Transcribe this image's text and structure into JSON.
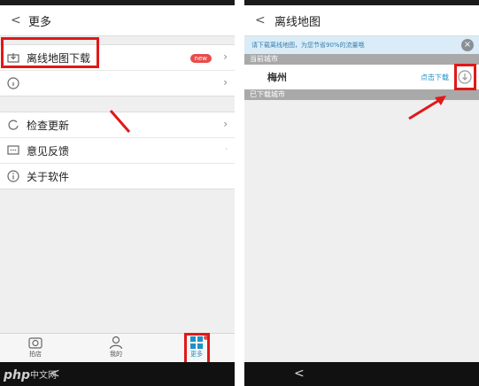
{
  "left_screen": {
    "header": {
      "back_glyph": "<",
      "title": "更多"
    },
    "menu_top": [
      {
        "label": "离线地图下载",
        "badge": "new",
        "icon": "offline-map-download-icon"
      },
      {
        "label": "",
        "icon": "info-icon"
      }
    ],
    "menu_bottom": [
      {
        "label": "检查更新",
        "icon": "refresh-icon"
      },
      {
        "label": "意见反馈",
        "icon": "feedback-icon"
      },
      {
        "label": "关于软件",
        "icon": "about-icon"
      }
    ],
    "bottom_nav": [
      {
        "label": "拍店",
        "icon": "camera-icon"
      },
      {
        "label": "我的",
        "icon": "person-icon"
      },
      {
        "label": "更多",
        "icon": "grid-icon"
      }
    ],
    "watermark": {
      "logo": "php",
      "text": "中文网"
    },
    "accent_red": "#e11818",
    "nav_active_color": "#1e90c8"
  },
  "right_screen": {
    "header": {
      "back_glyph": "<",
      "title": "离线地图"
    },
    "notice": "请下载离线地图，为您节省90%的流量哦",
    "section_current": "当前城市",
    "city": {
      "name": "梅州",
      "action_label": "点击下载"
    },
    "section_downloaded": "已下载城市",
    "sys_back_glyph": "<"
  }
}
